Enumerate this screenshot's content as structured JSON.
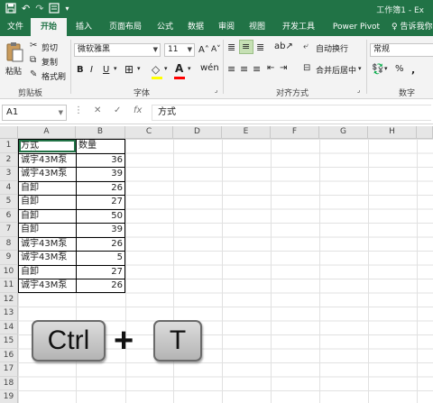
{
  "titlebar": {
    "title": "工作簿1 - Ex",
    "qat": [
      "save-icon",
      "undo-icon",
      "redo-icon",
      "form-icon",
      "customize-icon"
    ]
  },
  "tabs": [
    {
      "label": "文件",
      "active": false
    },
    {
      "label": "开始",
      "active": true
    },
    {
      "label": "插入",
      "active": false
    },
    {
      "label": "页面布局",
      "active": false
    },
    {
      "label": "公式",
      "active": false
    },
    {
      "label": "数据",
      "active": false
    },
    {
      "label": "审阅",
      "active": false
    },
    {
      "label": "视图",
      "active": false
    },
    {
      "label": "开发工具",
      "active": false
    },
    {
      "label": "Power Pivot",
      "active": false
    }
  ],
  "tell_me": "告诉我你想",
  "ribbon": {
    "clipboard": {
      "paste": "粘贴",
      "cut": "剪切",
      "copy": "复制",
      "format_painter": "格式刷",
      "label": "剪贴板"
    },
    "font": {
      "name": "微软雅黑",
      "size": "11",
      "bold": "B",
      "italic": "I",
      "underline": "U",
      "label": "字体"
    },
    "alignment": {
      "wrap": "自动换行",
      "merge": "合并后居中",
      "label": "对齐方式"
    },
    "number": {
      "format": "常规",
      "percent": "%",
      "comma": ",",
      "label": "数字"
    }
  },
  "formula_bar": {
    "name_box": "A1",
    "cancel": "✕",
    "enter": "✓",
    "fx": "fx",
    "content": "方式"
  },
  "columns": [
    "A",
    "B",
    "C",
    "D",
    "E",
    "F",
    "G",
    "H"
  ],
  "rows": [
    "1",
    "2",
    "3",
    "4",
    "5",
    "6",
    "7",
    "8",
    "9",
    "10",
    "11",
    "12",
    "13",
    "14",
    "15",
    "16",
    "17",
    "18",
    "19"
  ],
  "table": [
    {
      "a": "方式",
      "b": "数量"
    },
    {
      "a": "诚宇43M泵",
      "b": "36"
    },
    {
      "a": "诚宇43M泵",
      "b": "39"
    },
    {
      "a": "自卸",
      "b": "26"
    },
    {
      "a": "自卸",
      "b": "27"
    },
    {
      "a": "自卸",
      "b": "50"
    },
    {
      "a": "自卸",
      "b": "39"
    },
    {
      "a": "诚宇43M泵",
      "b": "26"
    },
    {
      "a": "诚宇43M泵",
      "b": "5"
    },
    {
      "a": "自卸",
      "b": "27"
    },
    {
      "a": "诚宇43M泵",
      "b": "26"
    }
  ],
  "shortcut": {
    "key1": "Ctrl",
    "plus": "+",
    "key2": "T"
  },
  "colors": {
    "accent": "#217346"
  }
}
